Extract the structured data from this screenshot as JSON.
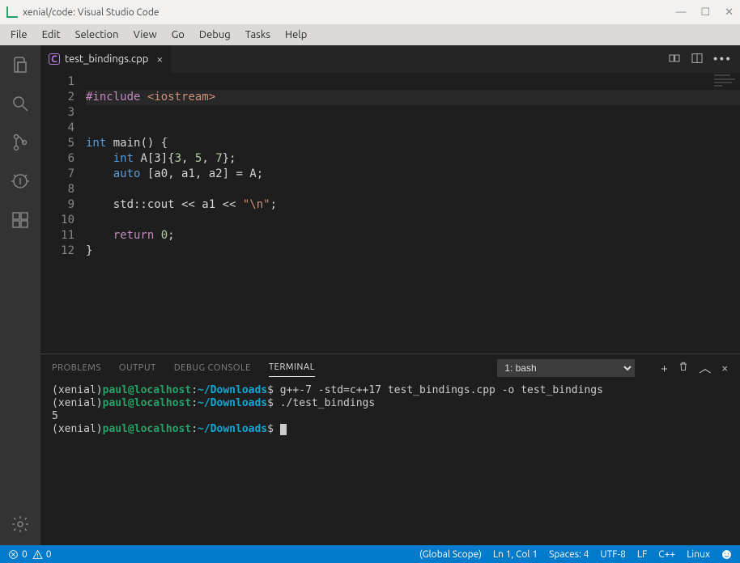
{
  "window": {
    "title": "xenial/code: Visual Studio Code"
  },
  "menubar": [
    "File",
    "Edit",
    "Selection",
    "View",
    "Go",
    "Debug",
    "Tasks",
    "Help"
  ],
  "tab": {
    "label": "test_bindings.cpp"
  },
  "gutter": [
    "1",
    "2",
    "3",
    "4",
    "5",
    "6",
    "7",
    "8",
    "9",
    "10",
    "11",
    "12"
  ],
  "code": {
    "l1a": "#include",
    "l1b": " <iostream>",
    "l3a": "int",
    "l3b": " main() {",
    "l4a": "    int",
    "l4b": " A[3]{",
    "l4n1": "3",
    "l4c1": ", ",
    "l4n2": "5",
    "l4c2": ", ",
    "l4n3": "7",
    "l4d": "};",
    "l5a": "    auto",
    "l5b": " [a0, a1, a2] = A;",
    "l7a": "    std::cout << a1 << ",
    "l7s": "\"\\n\"",
    "l7b": ";",
    "l9a": "    return",
    "l9n": " 0",
    "l9b": ";",
    "l10": "}"
  },
  "panel": {
    "tabs": {
      "problems": "PROBLEMS",
      "output": "OUTPUT",
      "debug": "DEBUG CONSOLE",
      "terminal": "TERMINAL"
    },
    "selector": "1: bash"
  },
  "terminal": {
    "distro": "(xenial)",
    "user": "paul@localhost",
    "path": "~/Downloads",
    "cmd1": " g++-7 -std=c++17 test_bindings.cpp -o test_bindings",
    "cmd2": " ./test_bindings",
    "out": "5",
    "dollar": "$"
  },
  "status": {
    "err": "0",
    "warn": "0",
    "scope": "(Global Scope)",
    "pos": "Ln 1, Col 1",
    "spaces": "Spaces: 4",
    "enc": "UTF-8",
    "eol": "LF",
    "lang": "C++",
    "os": "Linux"
  }
}
